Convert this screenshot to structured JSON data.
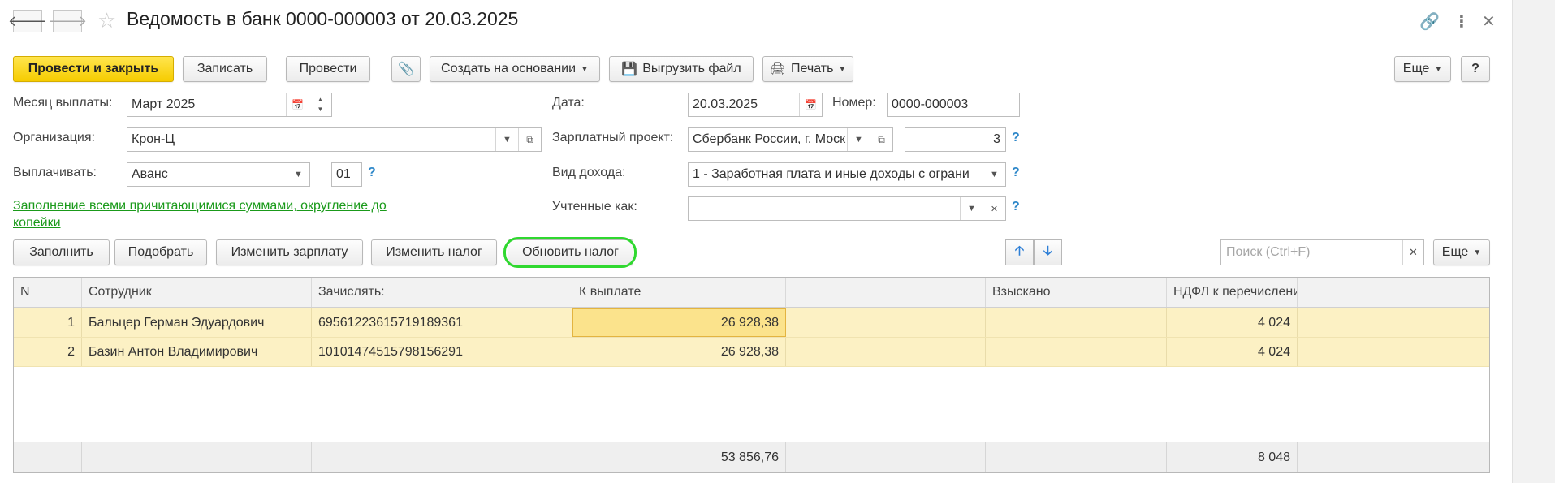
{
  "window": {
    "title": "Ведомость в банк 0000-000003 от 20.03.2025",
    "back_icon": "arrow-left-icon",
    "forward_icon": "arrow-right-icon",
    "favorite_icon": "star-icon",
    "link_icon": "link-icon",
    "more_icon": "more-vertical-icon",
    "close_icon": "close-icon"
  },
  "toolbar": {
    "post_close": "Провести и закрыть",
    "save": "Записать",
    "post": "Провести",
    "create_based_on": "Создать на основании",
    "export_file": "Выгрузить файл",
    "print": "Печать",
    "more": "Еще",
    "help": "?"
  },
  "form": {
    "month_label": "Месяц выплаты:",
    "month_value": "Март 2025",
    "org_label": "Организация:",
    "org_value": "Крон-Ц",
    "pay_label": "Выплачивать:",
    "pay_value": "Аванс",
    "pay_code": "01",
    "fill_link": "Заполнение всеми причитающимися суммами, округление до копейки",
    "date_label": "Дата:",
    "date_value": "20.03.2025",
    "number_label": "Номер:",
    "number_value": "0000-000003",
    "project_label": "Зарплатный проект:",
    "project_value": "Сбербанк России, г. Моск",
    "project_count": "3",
    "income_label": "Вид дохода:",
    "income_value": "1 - Заработная плата и иные доходы с ограни",
    "accounted_label": "Учтенные как:",
    "accounted_value": "",
    "help_mark": "?"
  },
  "table_toolbar": {
    "fill": "Заполнить",
    "pick": "Подобрать",
    "change_salary": "Изменить зарплату",
    "change_tax": "Изменить налог",
    "update_tax": "Обновить налог",
    "search_placeholder": "Поиск (Ctrl+F)",
    "more": "Еще"
  },
  "table": {
    "columns": [
      "N",
      "Сотрудник",
      "Зачислять:",
      "К выплате",
      "",
      "Взыскано",
      "НДФЛ к перечислению",
      ""
    ],
    "rows": [
      {
        "n": "1",
        "employee": "Бальцер Герман Эдуардович",
        "account": "69561223615719189361",
        "pay": "26 928,38",
        "collected": "",
        "ndfl": "4 024"
      },
      {
        "n": "2",
        "employee": "Базин Антон Владимирович",
        "account": "10101474515798156291",
        "pay": "26 928,38",
        "collected": "",
        "ndfl": "4 024"
      }
    ],
    "totals": {
      "pay": "53 856,76",
      "ndfl": "8 048"
    }
  }
}
